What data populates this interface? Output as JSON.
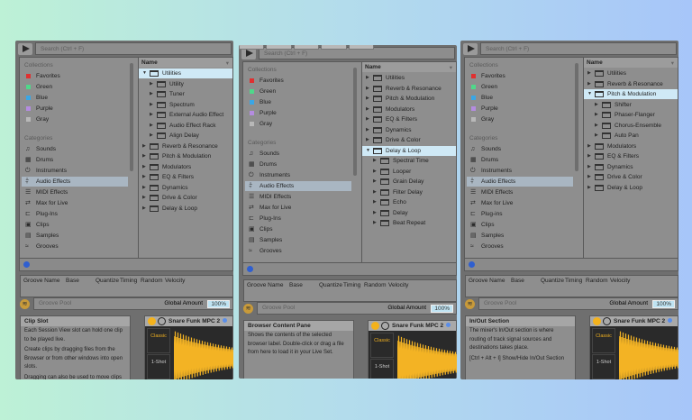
{
  "panels": [
    {
      "has_tabs": false,
      "search_placeholder": "Search (Ctrl + F)",
      "collections_header": "Collections",
      "collections": [
        {
          "label": "Favorites",
          "color": "#e03030"
        },
        {
          "label": "Green",
          "color": "#4fd88a"
        },
        {
          "label": "Blue",
          "color": "#3aa6e6"
        },
        {
          "label": "Purple",
          "color": "#b48ce0"
        },
        {
          "label": "Gray",
          "color": "#b8b8b8"
        }
      ],
      "categories_header": "Categories",
      "categories": [
        {
          "label": "Sounds",
          "icon": "♫"
        },
        {
          "label": "Drums",
          "icon": "▦"
        },
        {
          "label": "Instruments",
          "icon": "⏻"
        },
        {
          "label": "Audio Effects",
          "icon": "⫩",
          "selected": true
        },
        {
          "label": "MIDI Effects",
          "icon": "☰"
        },
        {
          "label": "Max for Live",
          "icon": "⇄"
        },
        {
          "label": "Plug-Ins",
          "icon": "⊏"
        },
        {
          "label": "Clips",
          "icon": "▣"
        },
        {
          "label": "Samples",
          "icon": "▤"
        },
        {
          "label": "Grooves",
          "icon": "≈"
        }
      ],
      "list_header": "Name",
      "rows": [
        {
          "label": "Utilities",
          "level": 0,
          "open": true,
          "selected": true
        },
        {
          "label": "Utility",
          "level": 1
        },
        {
          "label": "Tuner",
          "level": 1
        },
        {
          "label": "Spectrum",
          "level": 1
        },
        {
          "label": "External Audio Effect",
          "level": 1
        },
        {
          "label": "Audio Effect Rack",
          "level": 1
        },
        {
          "label": "Align Delay",
          "level": 1
        },
        {
          "label": "Reverb & Resonance",
          "level": 0
        },
        {
          "label": "Pitch & Modulation",
          "level": 0
        },
        {
          "label": "Modulators",
          "level": 0
        },
        {
          "label": "EQ & Filters",
          "level": 0
        },
        {
          "label": "Dynamics",
          "level": 0
        },
        {
          "label": "Drive & Color",
          "level": 0
        },
        {
          "label": "Delay & Loop",
          "level": 0
        }
      ],
      "groove_columns": [
        "Groove Name",
        "Base",
        "Quantize",
        "Timing",
        "Random",
        "Velocity"
      ],
      "groove_pool": "Groove Pool",
      "global_amount_label": "Global Amount",
      "global_amount": "100%",
      "info_title": "Clip Slot",
      "info_lines": [
        "Each Session View slot can hold one clip to be played live.",
        "Create clips by dragging files from the Browser or from other windows into open slots.",
        "Dragging can also be used to move clips"
      ],
      "clip_title": "Snare Funk MPC 2",
      "clip_mode1": "Classic",
      "clip_mode2": "1-Shot"
    },
    {
      "has_tabs": true,
      "search_placeholder": "Search (Ctrl + F)",
      "collections_header": "Collections",
      "collections": [
        {
          "label": "Favorites",
          "color": "#e03030"
        },
        {
          "label": "Green",
          "color": "#4fd88a"
        },
        {
          "label": "Blue",
          "color": "#3aa6e6"
        },
        {
          "label": "Purple",
          "color": "#b48ce0"
        },
        {
          "label": "Gray",
          "color": "#b8b8b8"
        }
      ],
      "categories_header": "Categories",
      "categories": [
        {
          "label": "Sounds",
          "icon": "♫"
        },
        {
          "label": "Drums",
          "icon": "▦"
        },
        {
          "label": "Instruments",
          "icon": "⏻"
        },
        {
          "label": "Audio Effects",
          "icon": "⫩",
          "selected": true
        },
        {
          "label": "MIDI Effects",
          "icon": "☰"
        },
        {
          "label": "Max for Live",
          "icon": "⇄"
        },
        {
          "label": "Plug-Ins",
          "icon": "⊏"
        },
        {
          "label": "Clips",
          "icon": "▣"
        },
        {
          "label": "Samples",
          "icon": "▤"
        },
        {
          "label": "Grooves",
          "icon": "≈"
        }
      ],
      "list_header": "Name",
      "rows": [
        {
          "label": "Utilities",
          "level": 0
        },
        {
          "label": "Reverb & Resonance",
          "level": 0
        },
        {
          "label": "Pitch & Modulation",
          "level": 0
        },
        {
          "label": "Modulators",
          "level": 0
        },
        {
          "label": "EQ & Filters",
          "level": 0
        },
        {
          "label": "Dynamics",
          "level": 0
        },
        {
          "label": "Drive & Color",
          "level": 0
        },
        {
          "label": "Delay & Loop",
          "level": 0,
          "open": true,
          "selected": true
        },
        {
          "label": "Spectral Time",
          "level": 1
        },
        {
          "label": "Looper",
          "level": 1
        },
        {
          "label": "Grain Delay",
          "level": 1
        },
        {
          "label": "Filter Delay",
          "level": 1
        },
        {
          "label": "Echo",
          "level": 1
        },
        {
          "label": "Delay",
          "level": 1
        },
        {
          "label": "Beat Repeat",
          "level": 1
        }
      ],
      "groove_columns": [
        "Groove Name",
        "Base",
        "Quantize",
        "Timing",
        "Random",
        "Velocity"
      ],
      "groove_pool": "Groove Pool",
      "global_amount_label": "Global Amount",
      "global_amount": "100%",
      "info_title": "Browser Content Pane",
      "info_lines": [
        "Shows the contents of the selected browser label. Double-click or drag a file from here to load it in your Live Set."
      ],
      "clip_title": "Snare Funk MPC 2",
      "clip_mode1": "Classic",
      "clip_mode2": "1-Shot"
    },
    {
      "has_tabs": false,
      "search_placeholder": "Search (Ctrl + F)",
      "collections_header": "Collections",
      "collections": [
        {
          "label": "Favorites",
          "color": "#e03030"
        },
        {
          "label": "Green",
          "color": "#4fd88a"
        },
        {
          "label": "Blue",
          "color": "#3aa6e6"
        },
        {
          "label": "Purple",
          "color": "#b48ce0"
        },
        {
          "label": "Gray",
          "color": "#b8b8b8"
        }
      ],
      "categories_header": "Categories",
      "categories": [
        {
          "label": "Sounds",
          "icon": "♫"
        },
        {
          "label": "Drums",
          "icon": "▦"
        },
        {
          "label": "Instruments",
          "icon": "⏻"
        },
        {
          "label": "Audio Effects",
          "icon": "⫩",
          "selected": true
        },
        {
          "label": "MIDI Effects",
          "icon": "☰"
        },
        {
          "label": "Max for Live",
          "icon": "⇄"
        },
        {
          "label": "Plug-ins",
          "icon": "⊏"
        },
        {
          "label": "Clips",
          "icon": "▣"
        },
        {
          "label": "Samples",
          "icon": "▤"
        },
        {
          "label": "Grooves",
          "icon": "≈"
        }
      ],
      "list_header": "Name",
      "rows": [
        {
          "label": "Utilities",
          "level": 0
        },
        {
          "label": "Reverb & Resonance",
          "level": 0
        },
        {
          "label": "Pitch & Modulation",
          "level": 0,
          "open": true,
          "selected": true
        },
        {
          "label": "Shifter",
          "level": 1
        },
        {
          "label": "Phaser-Flanger",
          "level": 1
        },
        {
          "label": "Chorus-Ensemble",
          "level": 1
        },
        {
          "label": "Auto Pan",
          "level": 1
        },
        {
          "label": "Modulators",
          "level": 0
        },
        {
          "label": "EQ & Filters",
          "level": 0
        },
        {
          "label": "Dynamics",
          "level": 0
        },
        {
          "label": "Drive & Color",
          "level": 0
        },
        {
          "label": "Delay & Loop",
          "level": 0
        }
      ],
      "groove_columns": [
        "Groove Name",
        "Base",
        "Quantize",
        "Timing",
        "Random",
        "Velocity"
      ],
      "groove_pool": "Groove Pool",
      "global_amount_label": "Global Amount",
      "global_amount": "100%",
      "info_title": "In/Out Section",
      "info_lines": [
        "The mixer's In/Out section is where routing of track signal sources and destinations takes place.",
        "[Ctrl + Alt + I] Show/Hide In/Out Section"
      ],
      "clip_title": "Snare Funk MPC 2",
      "clip_mode1": "Classic",
      "clip_mode2": "1-Shot"
    }
  ]
}
